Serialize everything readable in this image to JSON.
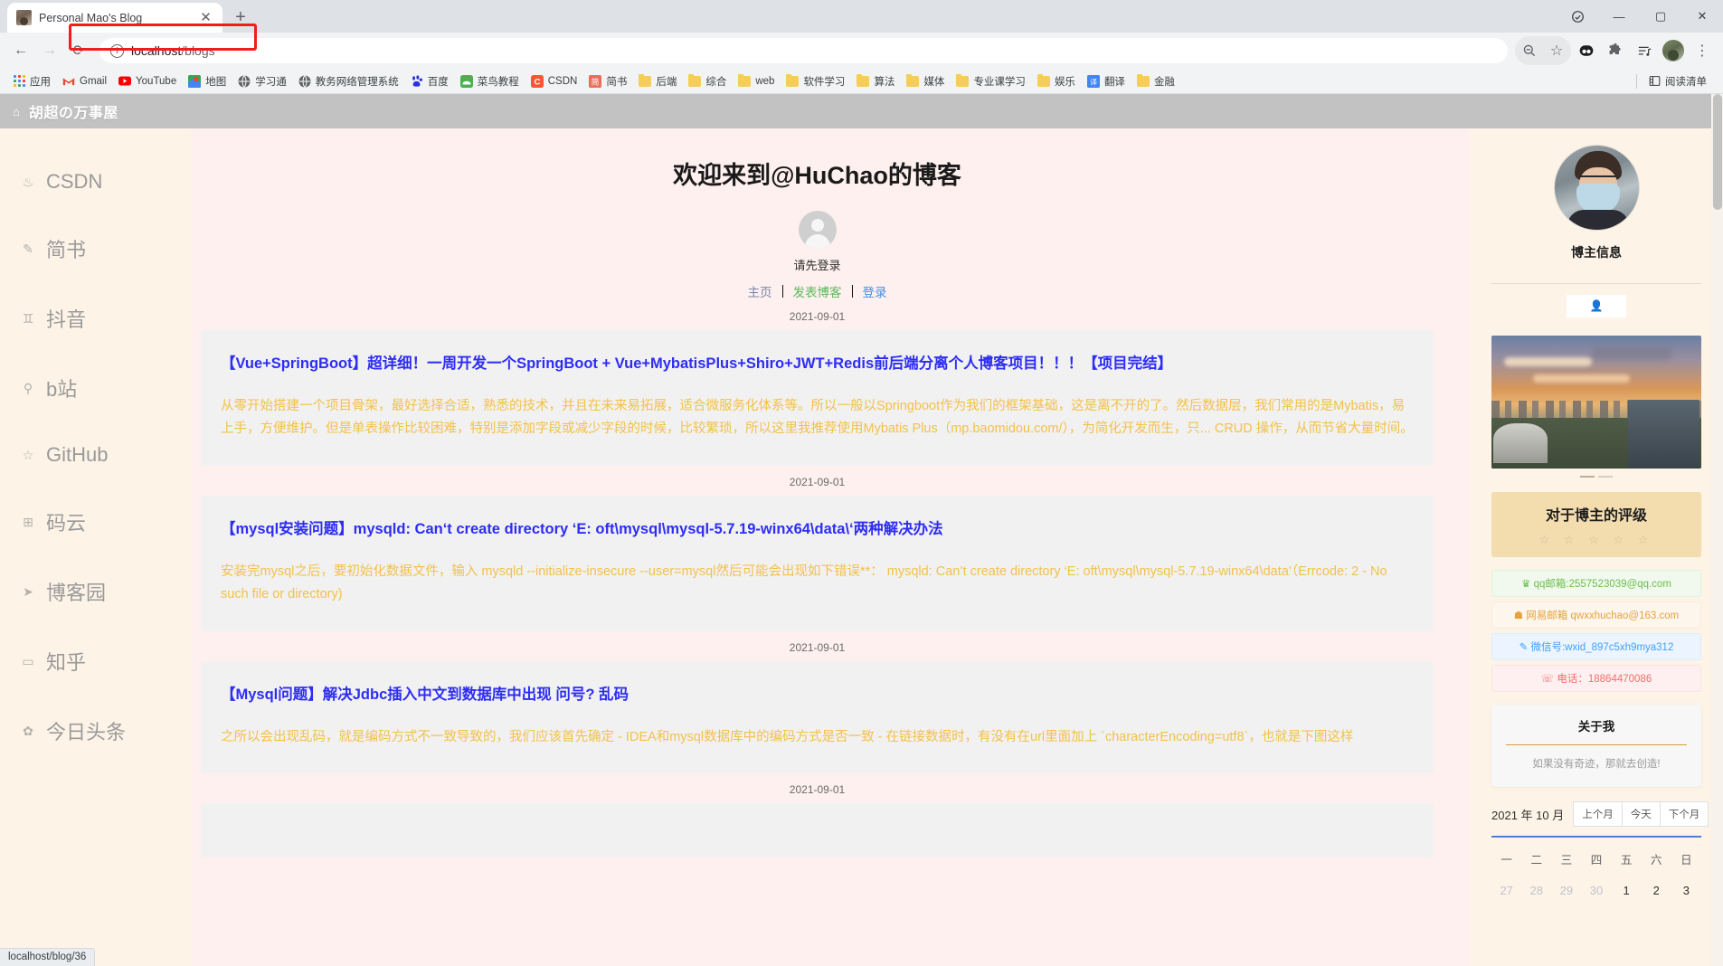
{
  "browser": {
    "tab": {
      "title": "Personal Mao's Blog",
      "favicon": "photo-favicon",
      "close": "✕"
    },
    "new_tab": "+",
    "window_controls": {
      "minimize": "—",
      "maximize": "▢",
      "close": "✕"
    },
    "nav": {
      "back": "←",
      "forward": "→",
      "reload": "⟳"
    },
    "omnibox": {
      "secure_icon": "ⓘ",
      "host": "localhost",
      "path": "/blogs"
    },
    "toolbar_right": {
      "zoom_out": "zoom-out-icon",
      "bookmark_star": "☆",
      "extension_dino": "dino-icon",
      "extensions": "puzzle-icon",
      "media": "media-list-icon",
      "profile": "profile-avatar",
      "menu": "⋮"
    },
    "bookmarks": [
      {
        "label": "应用",
        "icon": "apps-grid"
      },
      {
        "label": "Gmail",
        "icon": "gmail-icon"
      },
      {
        "label": "YouTube",
        "icon": "youtube-icon"
      },
      {
        "label": "地图",
        "icon": "maps-icon"
      },
      {
        "label": "学习通",
        "icon": "globe-icon"
      },
      {
        "label": "教务网络管理系统",
        "icon": "globe-icon"
      },
      {
        "label": "百度",
        "icon": "baidu-icon"
      },
      {
        "label": "菜鸟教程",
        "icon": "runoob-icon"
      },
      {
        "label": "CSDN",
        "icon": "csdn-icon"
      },
      {
        "label": "简书",
        "icon": "jianshu-icon"
      },
      {
        "label": "后端",
        "icon": "folder-icon"
      },
      {
        "label": "综合",
        "icon": "folder-icon"
      },
      {
        "label": "web",
        "icon": "folder-icon"
      },
      {
        "label": "软件学习",
        "icon": "folder-icon"
      },
      {
        "label": "算法",
        "icon": "folder-icon"
      },
      {
        "label": "媒体",
        "icon": "folder-icon"
      },
      {
        "label": "专业课学习",
        "icon": "folder-icon"
      },
      {
        "label": "娱乐",
        "icon": "folder-icon"
      },
      {
        "label": "翻译",
        "icon": "translate-icon"
      },
      {
        "label": "金融",
        "icon": "folder-icon"
      }
    ],
    "reading_list": {
      "label": "阅读清单",
      "icon": "reading-list-icon"
    },
    "status_bar": "localhost/blog/36"
  },
  "site": {
    "header": {
      "home_icon": "home-icon",
      "title": "胡超の万事屋"
    },
    "left_nav": [
      {
        "label": "CSDN",
        "icon": "cup-icon"
      },
      {
        "label": "简书",
        "icon": "pen-icon"
      },
      {
        "label": "抖音",
        "icon": "goblet-icon"
      },
      {
        "label": "b站",
        "icon": "key-icon"
      },
      {
        "label": "GitHub",
        "icon": "star-icon"
      },
      {
        "label": "码云",
        "icon": "grid-icon"
      },
      {
        "label": "博客园",
        "icon": "send-icon"
      },
      {
        "label": "知乎",
        "icon": "comment-icon"
      },
      {
        "label": "今日头条",
        "icon": "gear-icon"
      }
    ],
    "welcome_title": "欢迎来到@HuChao的博客",
    "user": {
      "avatar": "default-user-avatar",
      "login_note": "请先登录",
      "links": [
        {
          "label": "主页",
          "color": "#7a86a8"
        },
        {
          "label": "发表博客",
          "color": "#5cb85c"
        },
        {
          "label": "登录",
          "color": "#4a90e2"
        }
      ]
    },
    "posts": [
      {
        "date": "2021-09-01",
        "title": "【Vue+SpringBoot】超详细！一周开发一个SpringBoot + Vue+MybatisPlus+Shiro+JWT+Redis前后端分离个人博客项目！！！【项目完结】",
        "summary": "从零开始搭建一个项目骨架，最好选择合适，熟悉的技术，并且在未来易拓展，适合微服务化体系等。所以一般以Springboot作为我们的框架基础，这是离不开的了。然后数据层，我们常用的是Mybatis，易上手，方便维护。但是单表操作比较困难，特别是添加字段或减少字段的时候，比较繁琐，所以这里我推荐使用Mybatis Plus（mp.baomidou.com/），为简化开发而生，只... CRUD 操作，从而节省大量时间。"
      },
      {
        "date": "2021-09-01",
        "title": "【mysql安装问题】mysqld: Can‘t create directory ‘E: oft\\mysql\\mysql-5.7.19-winx64\\data\\‘两种解决办法",
        "summary": "安装完mysql之后，要初始化数据文件，输入 mysqld --initialize-insecure --user=mysql然后可能会出现如下错误**： mysqld: Can’t create directory ‘E: oft\\mysql\\mysql-5.7.19-winx64\\data’（Errcode: 2 - No such file or directory)"
      },
      {
        "date": "2021-09-01",
        "title": "【Mysql问题】解决Jdbc插入中文到数据库中出现 问号? 乱码",
        "summary": "之所以会出现乱码，就是编码方式不一致导致的，我们应该首先确定 - IDEA和mysql数据库中的编码方式是否一致 - 在链接数据时，有没有在url里面加上 `characterEncoding=utf8`，也就是下图这样"
      },
      {
        "date": "2021-09-01",
        "title": "",
        "summary": ""
      }
    ]
  },
  "right_panel": {
    "profile_image": "blogger-photo",
    "blogger_title": "博主信息",
    "person_tab_icon": "person-icon",
    "scenery_image": "campus-sunset-photo",
    "rating": {
      "title": "对于博主的评级",
      "stars": "☆ ☆ ☆ ☆ ☆",
      "star_count": 5,
      "filled": 0
    },
    "contacts": [
      {
        "icon": "♛",
        "text": "qq邮箱:2557523039@qq.com",
        "style": "c-qq"
      },
      {
        "icon": "☗",
        "text": "网易邮箱 qwxxhuchao@163.com",
        "style": "c-163"
      },
      {
        "icon": "✎",
        "text": "微信号:wxid_897c5xh9mya312",
        "style": "c-wx"
      },
      {
        "icon": "☏",
        "text": "电话：18864470086",
        "style": "c-tel"
      }
    ],
    "about": {
      "title": "关于我",
      "text": "如果没有奇迹，那就去创造!"
    },
    "calendar": {
      "month_label": "2021 年 10 月",
      "buttons": [
        "上个月",
        "今天",
        "下个月"
      ],
      "dow": [
        "一",
        "二",
        "三",
        "四",
        "五",
        "六",
        "日"
      ],
      "days": [
        {
          "n": "27",
          "mute": true
        },
        {
          "n": "28",
          "mute": true
        },
        {
          "n": "29",
          "mute": true
        },
        {
          "n": "30",
          "mute": true
        },
        {
          "n": "1",
          "mute": false
        },
        {
          "n": "2",
          "mute": false
        },
        {
          "n": "3",
          "mute": false
        }
      ]
    }
  }
}
